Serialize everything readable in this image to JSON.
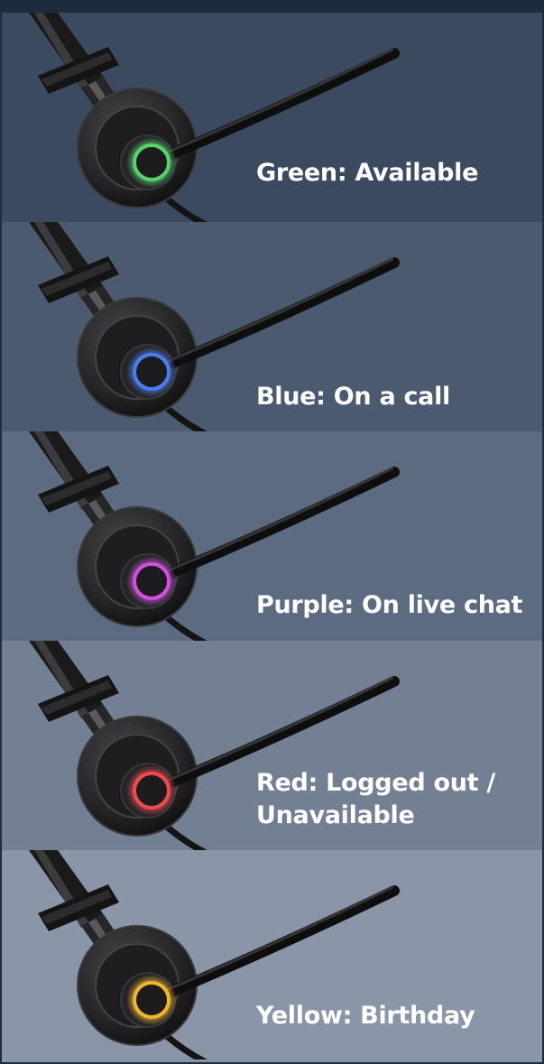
{
  "panels": [
    {
      "label": "Green: Available",
      "color": "green",
      "ring_color": "#56d36a",
      "bg": "#3b4a5e"
    },
    {
      "label": "Blue: On a call",
      "color": "blue",
      "ring_color": "#4d7cf0",
      "bg": "#4b5a6e"
    },
    {
      "label": "Purple: On live chat",
      "color": "purple",
      "ring_color": "#d24fdc",
      "bg": "#5d6b80"
    },
    {
      "label": "Red: Logged out /\nUnavailable",
      "color": "red",
      "ring_color": "#f04a50",
      "bg": "#737f92"
    },
    {
      "label": "Yellow: Birthday",
      "color": "yellow",
      "ring_color": "#f2b62c",
      "bg": "#8a96a8"
    }
  ]
}
